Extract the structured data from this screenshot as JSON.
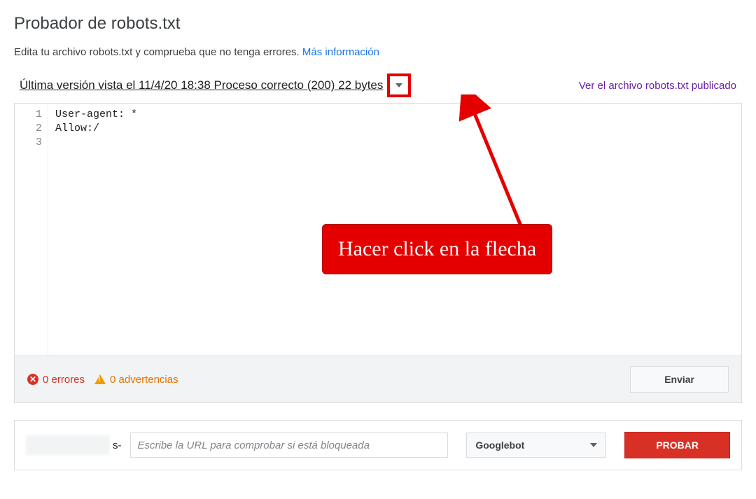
{
  "title": "Probador de robots.txt",
  "intro_text": "Edita tu archivo robots.txt y comprueba que no tenga errores. ",
  "intro_link": "Más información",
  "status_text": "Última versión vista el 11/4/20 18:38 Proceso correcto (200) 22 bytes",
  "view_published_link": "Ver el archivo robots.txt publicado",
  "editor_lines": [
    "User-agent: *",
    "Allow:/",
    ""
  ],
  "errors": {
    "count": "0",
    "label": "errores"
  },
  "warnings": {
    "count": "0",
    "label": "advertencias"
  },
  "submit_button": "Enviar",
  "domain_suffix": "s-",
  "url_placeholder": "Escribe la URL para comprobar si está bloqueada",
  "bot_selected": "Googlebot",
  "test_button": "PROBAR",
  "callout_text": "Hacer click en la flecha"
}
